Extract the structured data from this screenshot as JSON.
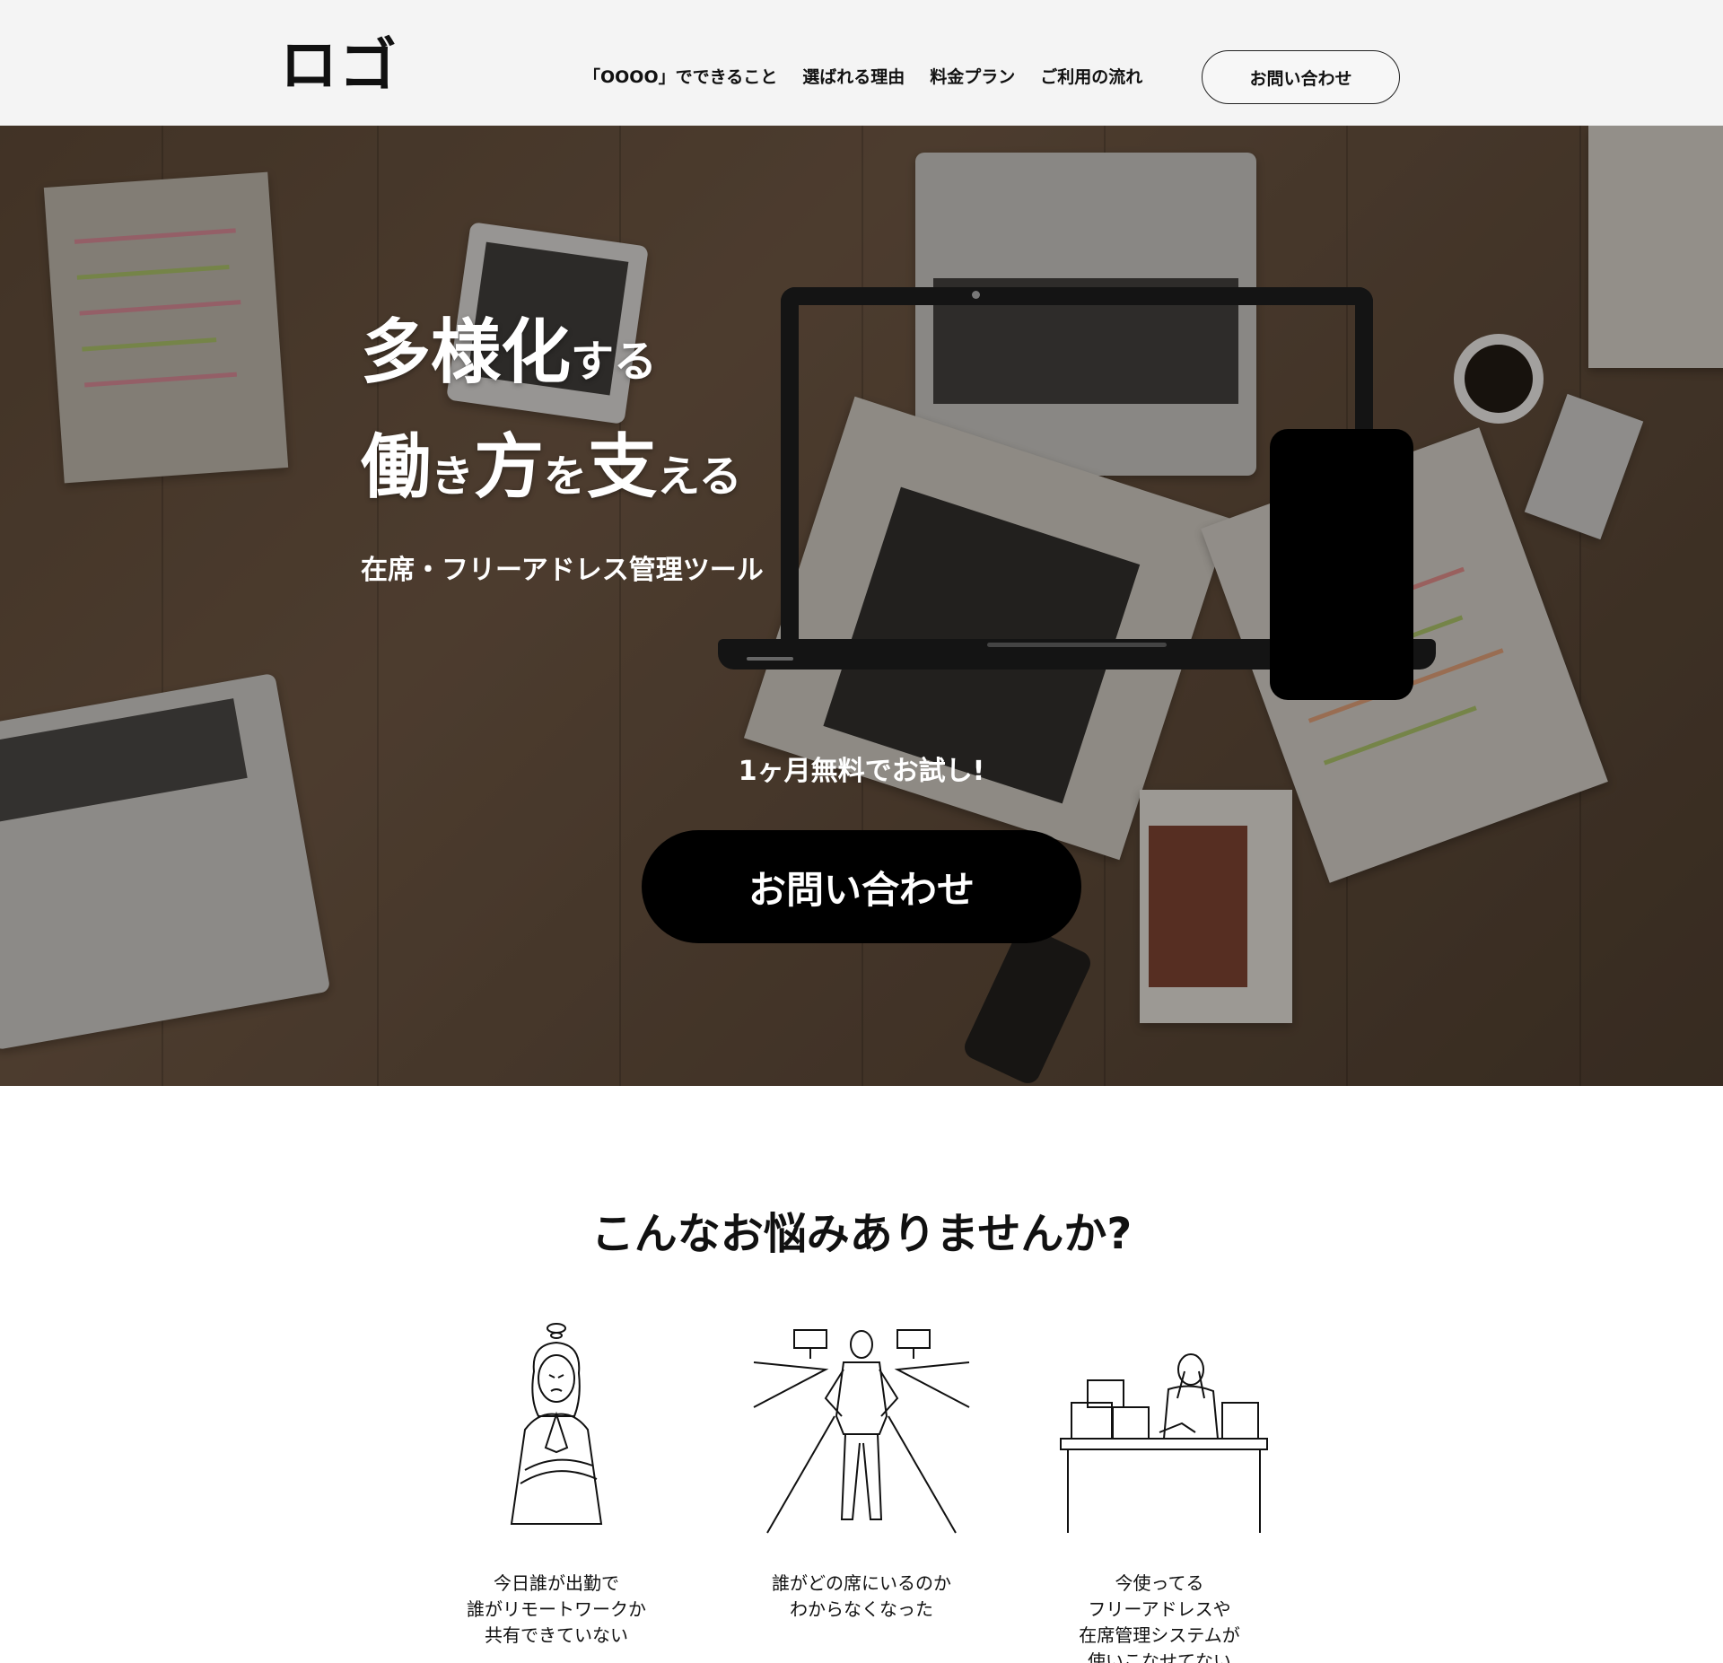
{
  "header": {
    "logo": "ロゴ",
    "nav": [
      "「OOOO」でできること",
      "選ばれる理由",
      "料金プラン",
      "ご利用の流れ"
    ],
    "cta_label": "お問い合わせ"
  },
  "hero": {
    "title_line1_big": "多様化",
    "title_line1_small": "する",
    "title_line2_big1": "働",
    "title_line2_small1": "き",
    "title_line2_big2": "方",
    "title_line2_small2": "を",
    "title_line2_big3": "支",
    "title_line2_small3": "える",
    "subtitle": "在席・フリーアドレス管理ツール",
    "trial_text": "1ヶ月無料でお試し!",
    "cta_label": "お問い合わせ"
  },
  "problems": {
    "heading": "こんなお悩みありませんか?",
    "items": [
      {
        "line1": "今日誰が出勤で",
        "line2": "誰がリモートワークか",
        "line3": "共有できていない",
        "line4": ""
      },
      {
        "line1": "誰がどの席にいるのか",
        "line2": "わからなくなった",
        "line3": "",
        "line4": ""
      },
      {
        "line1": "今使ってる",
        "line2": "フリーアドレスや",
        "line3": "在席管理システムが",
        "line4": "使いこなせてない"
      }
    ]
  },
  "colors": {
    "header_bg": "#f4f4f4",
    "cta_bg": "#000000",
    "hero_text": "#ffffff"
  }
}
